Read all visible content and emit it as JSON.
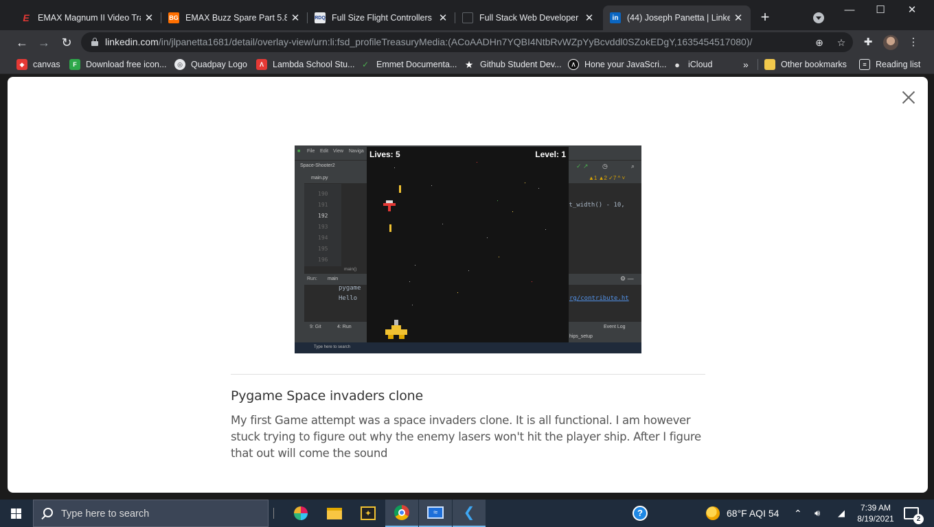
{
  "browser": {
    "tabs": [
      {
        "title": "EMAX Magnum II Video Tran",
        "favicon": "emax-logo",
        "color": "#e53935",
        "letter": "E"
      },
      {
        "title": "EMAX Buzz Spare Part 5.8G ",
        "favicon": "bg-logo",
        "color": "#ff6f00",
        "letter": "BG"
      },
      {
        "title": "Full Size Flight Controllers (3",
        "favicon": "rdq-logo",
        "color": "#e8eaed",
        "letter": "RDQ"
      },
      {
        "title": "Full Stack Web Developer",
        "favicon": "dev-logo",
        "color": "#202124",
        "letter": ""
      },
      {
        "title": "(44) Joseph Panetta | Linked",
        "favicon": "linkedin-logo",
        "color": "#0a66c2",
        "letter": "in"
      }
    ],
    "new_tab": "+",
    "window": {
      "minimize": "—",
      "maximize": "☐",
      "close": "✕"
    },
    "url": {
      "host": "linkedin.com",
      "path": "/in/jlpanetta1681/detail/overlay-view/urn:li:fsd_profileTreasuryMedia:(ACoAADHn7YQBI4NtbRvWZpYyBcvddl0SZokEDgY,1635454517080)/"
    },
    "bookmarks": [
      {
        "label": "canvas",
        "icon": "canvas-icon",
        "color": "#e53935"
      },
      {
        "label": "Download free icon...",
        "icon": "flaticon-icon",
        "color": "#2ea84a"
      },
      {
        "label": "Quadpay Logo",
        "icon": "globe-icon",
        "color": "#5f6368"
      },
      {
        "label": "Lambda School Stu...",
        "icon": "lambda-icon",
        "color": "#e53935"
      },
      {
        "label": "Emmet Documenta...",
        "icon": "emmet-icon",
        "color": "#2e7d32"
      },
      {
        "label": "Github Student Dev...",
        "icon": "star-icon",
        "color": "#35363a"
      },
      {
        "label": "Hone your JavaScri...",
        "icon": "lambda-circle-icon",
        "color": "#111"
      },
      {
        "label": "iCloud",
        "icon": "apple-icon",
        "color": "#35363a"
      }
    ],
    "bookmarks_overflow": "»",
    "other_bookmarks": "Other bookmarks",
    "reading_list": "Reading list"
  },
  "modal": {
    "title": "Pygame Space invaders clone",
    "description": "My first Game attempt was a space invaders clone. It is all functional. I am however stuck trying to figure out why the enemy lasers won't hit the player ship. After I figure that out will come the sound",
    "media": {
      "project": "Space-Shooter2",
      "menu": [
        "File",
        "Edit",
        "View",
        "Naviga"
      ],
      "tab_file": "main.py",
      "line_numbers": [
        "190",
        "191",
        "192",
        "193",
        "194",
        "195",
        "196"
      ],
      "code_fragment": "et_width() - 10,",
      "crumb": "main()",
      "run_label": "Run:",
      "run_tab": "main",
      "console": [
        "pygame",
        "Hello"
      ],
      "console_link": "rg/contribute.ht",
      "git_label": "9: Git",
      "run_button": "4: Run",
      "event_log": "Event Log",
      "status": "hips_setup",
      "game": {
        "lives_label": "Lives: 5",
        "level_label": "Level: 1"
      },
      "taskbar_search": "Type here to search"
    }
  },
  "taskbar": {
    "search_placeholder": "Type here to search",
    "weather": "68°F  AQI 54",
    "time": "7:39 AM",
    "date": "8/19/2021",
    "notifications": "2"
  }
}
